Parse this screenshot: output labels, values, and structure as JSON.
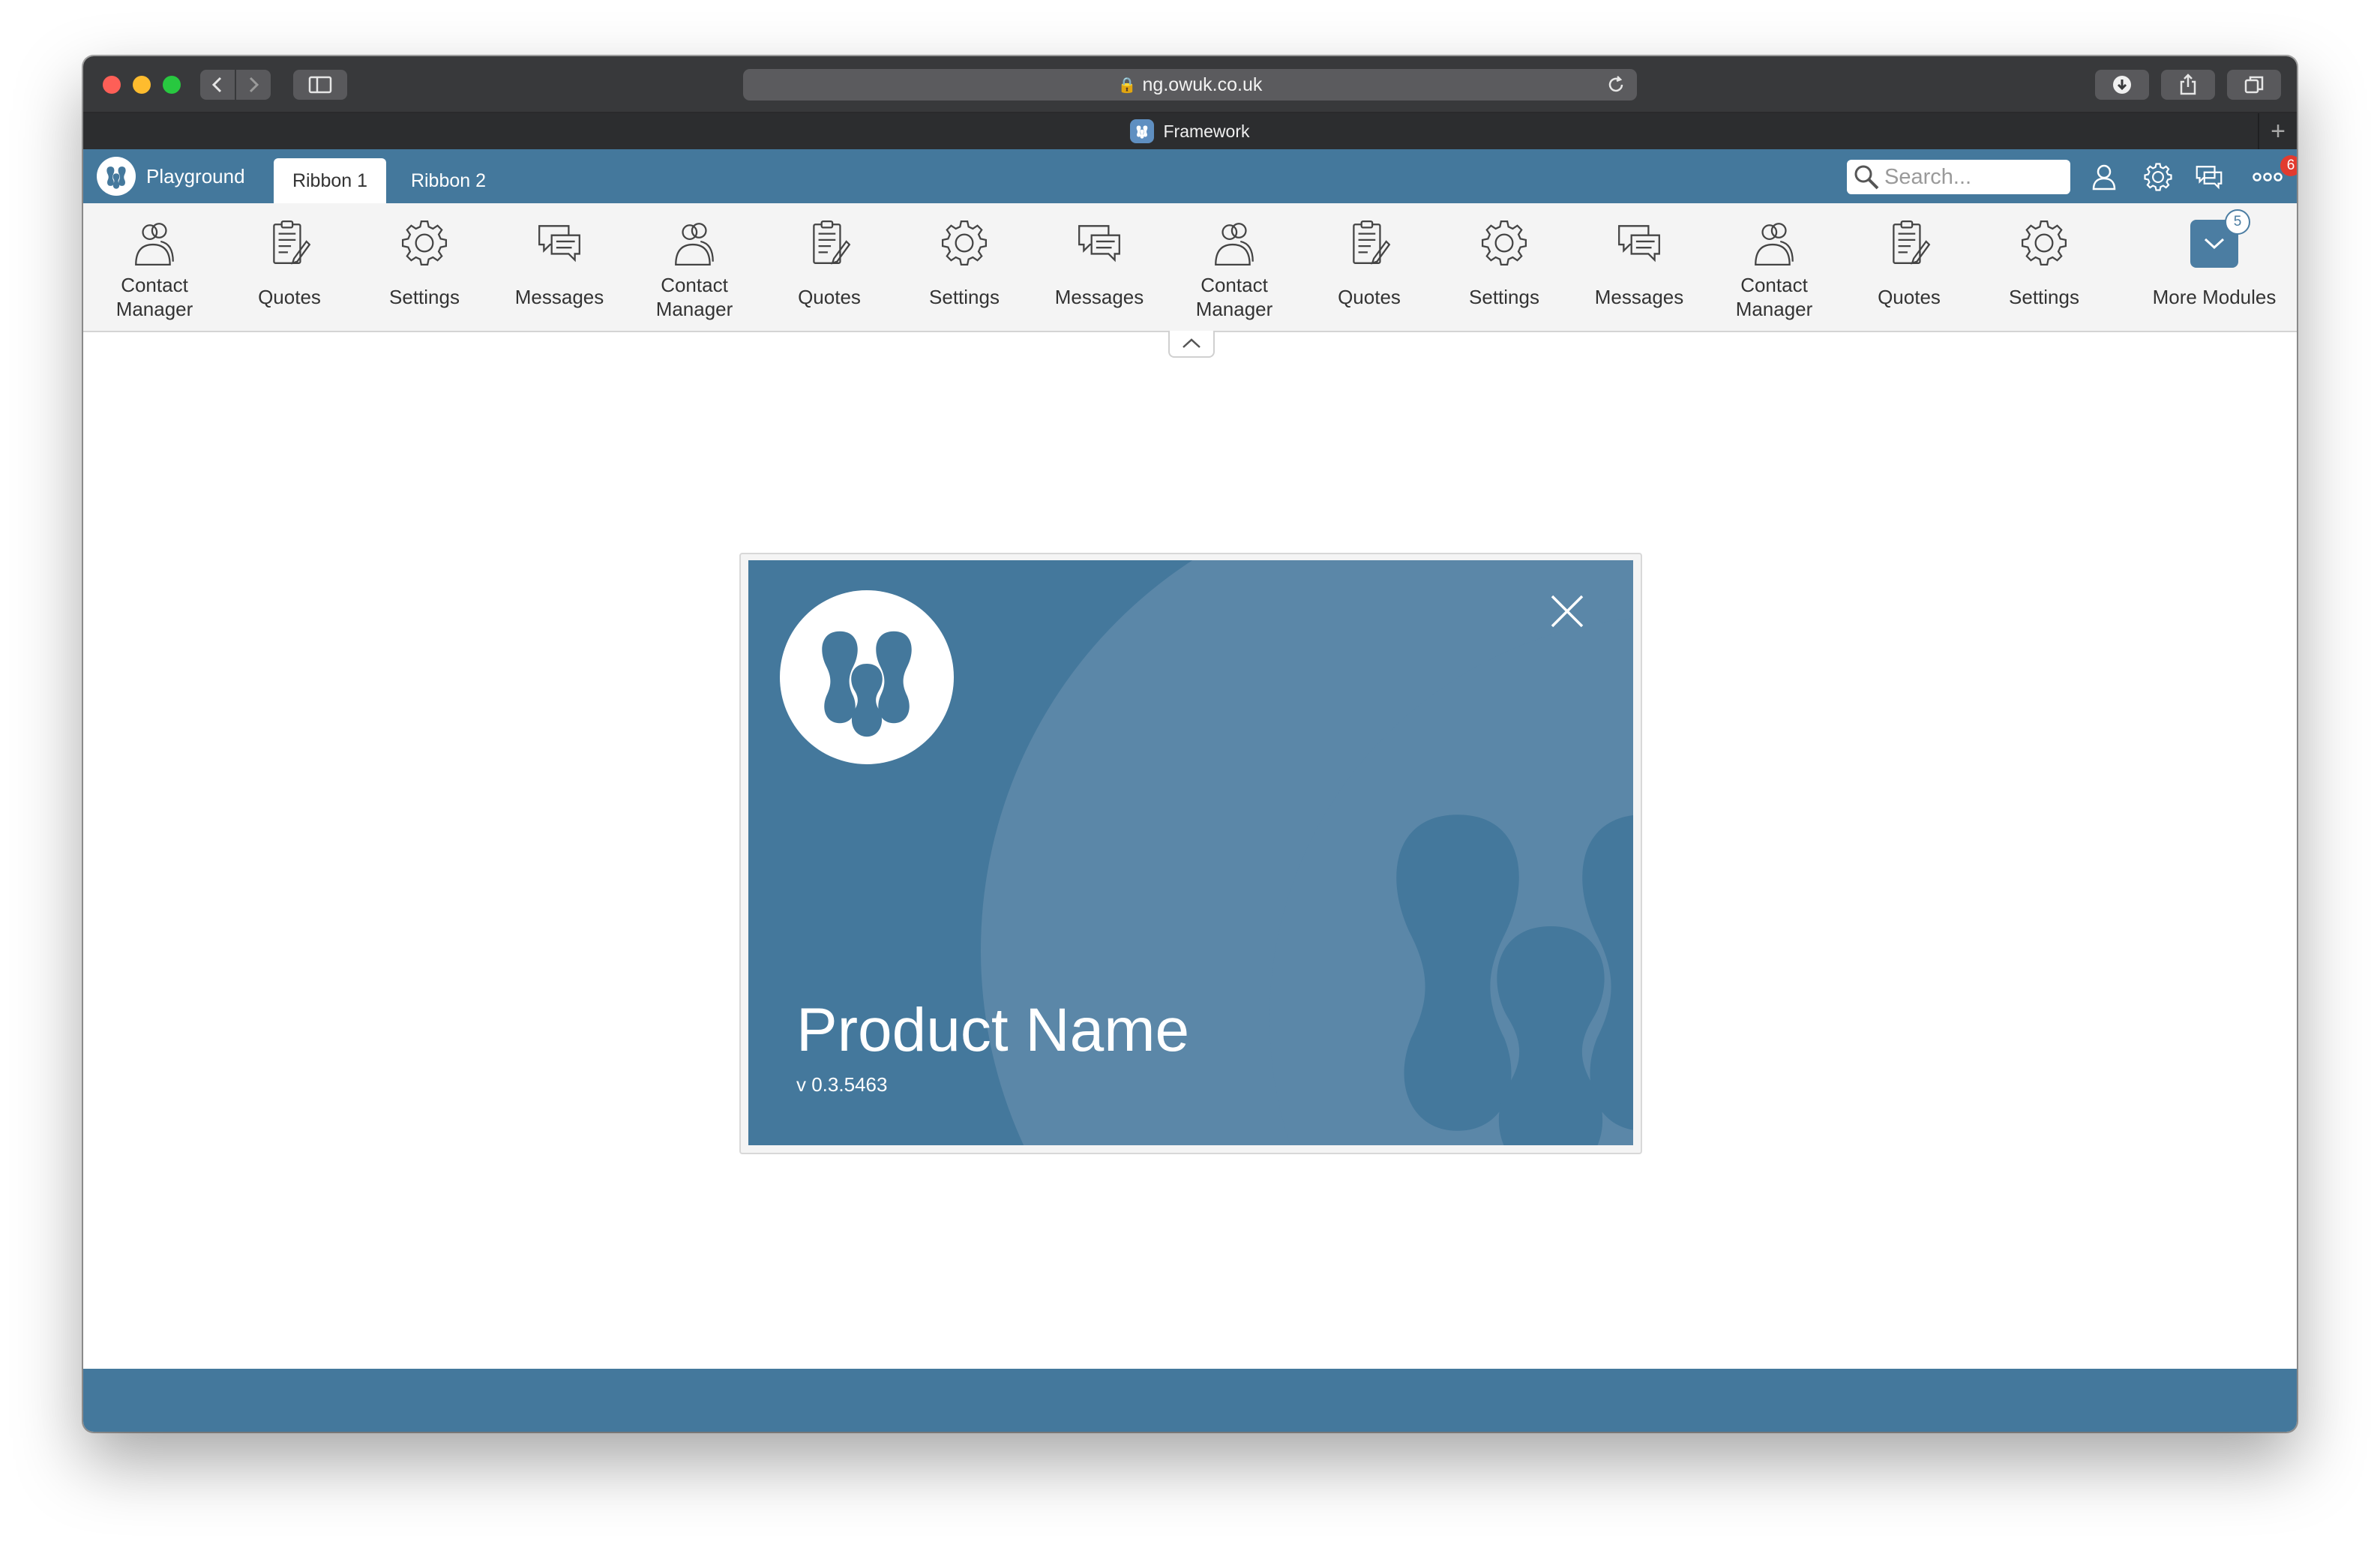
{
  "browser": {
    "url": "ng.owuk.co.uk",
    "tab_title": "Framework"
  },
  "app": {
    "brand": "Playground",
    "tabs": [
      {
        "label": "Ribbon 1",
        "active": true
      },
      {
        "label": "Ribbon 2",
        "active": false
      }
    ],
    "search_placeholder": "Search...",
    "notification_count": "6"
  },
  "ribbon": {
    "items": [
      {
        "label": "Contact Manager",
        "icon": "contacts-icon"
      },
      {
        "label": "Quotes",
        "icon": "quotes-icon"
      },
      {
        "label": "Settings",
        "icon": "gear-icon"
      },
      {
        "label": "Messages",
        "icon": "messages-icon"
      },
      {
        "label": "Contact Manager",
        "icon": "contacts-icon"
      },
      {
        "label": "Quotes",
        "icon": "quotes-icon"
      },
      {
        "label": "Settings",
        "icon": "gear-icon"
      },
      {
        "label": "Messages",
        "icon": "messages-icon"
      },
      {
        "label": "Contact Manager",
        "icon": "contacts-icon"
      },
      {
        "label": "Quotes",
        "icon": "quotes-icon"
      },
      {
        "label": "Settings",
        "icon": "gear-icon"
      },
      {
        "label": "Messages",
        "icon": "messages-icon"
      },
      {
        "label": "Contact Manager",
        "icon": "contacts-icon"
      },
      {
        "label": "Quotes",
        "icon": "quotes-icon"
      },
      {
        "label": "Settings",
        "icon": "gear-icon"
      }
    ],
    "more": {
      "label": "More Modules",
      "count": "5"
    }
  },
  "dialog": {
    "product_name": "Product Name",
    "version": "v 0.3.5463"
  },
  "colors": {
    "brand_blue": "#44789c",
    "badge_red": "#e23b2f"
  }
}
